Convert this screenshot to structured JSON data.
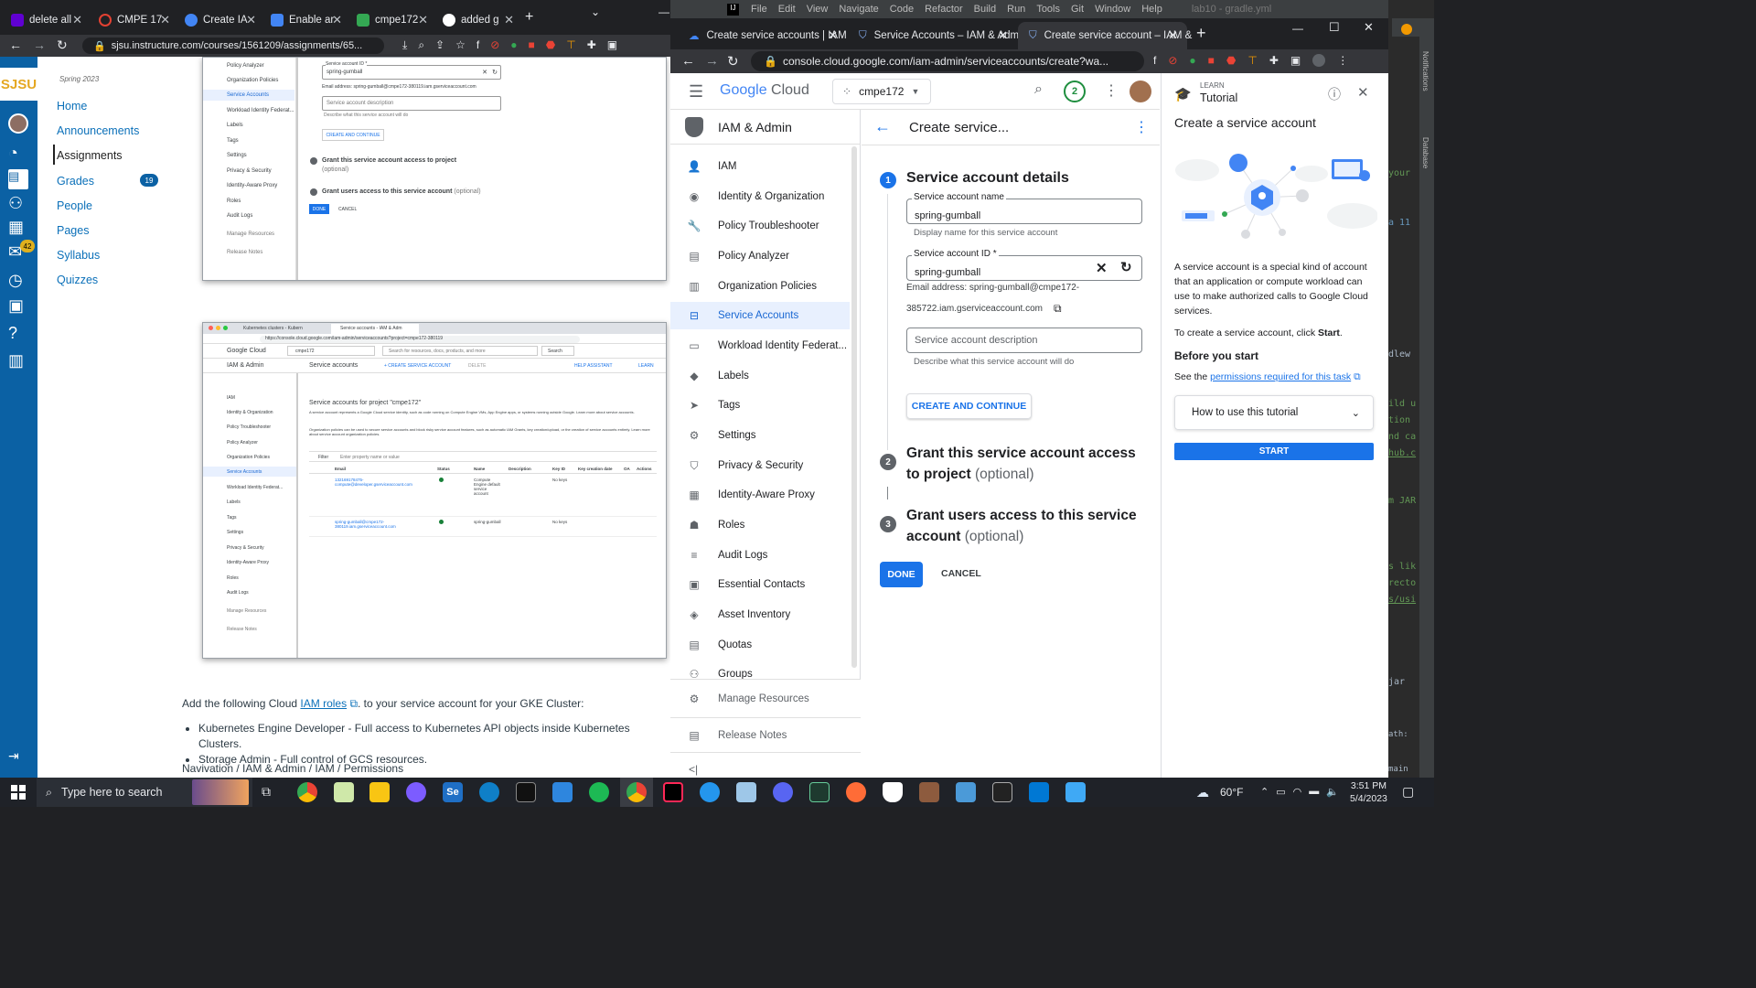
{
  "left_browser": {
    "tabs": [
      {
        "label": "delete all",
        "favicon_color": "#6001d2"
      },
      {
        "label": "CMPE 17",
        "favicon_color": "#e34132"
      },
      {
        "label": "Create IA",
        "favicon_color": "#4285f4"
      },
      {
        "label": "Enable ar",
        "favicon_color": "#4285f4"
      },
      {
        "label": "cmpe172",
        "favicon_color": "#34a853"
      },
      {
        "label": "added g",
        "favicon_color": "#ffffff"
      }
    ],
    "url": "sjsu.instructure.com/courses/1561209/assignments/65...",
    "canvas": {
      "logo": "SJSU",
      "term": "Spring 2023",
      "links": [
        "Home",
        "Announcements",
        "Assignments",
        "Grades",
        "People",
        "Pages",
        "Syllabus",
        "Quizzes"
      ],
      "grades_badge": "19",
      "inbox_badge": "42"
    },
    "embedded_shot1": {
      "sidebar": [
        "Policy Analyzer",
        "Organization Policies",
        "Service Accounts",
        "Workload Identity Federat...",
        "Labels",
        "Tags",
        "Settings",
        "Privacy & Security",
        "Identity-Aware Proxy",
        "Roles",
        "Audit Logs",
        "Manage Resources",
        "Release Notes"
      ],
      "id_label": "Service account ID *",
      "id_value": "spring-gumball",
      "email": "Email address: spring-gumball@cmpe172-380119.iam.gserviceaccount.com",
      "desc_placeholder": "Service account description",
      "desc_helper": "Describe what this service account will do",
      "create_btn": "CREATE AND CONTINUE",
      "step2": "Grant this service account access to project",
      "step2_opt": "(optional)",
      "step3": "Grant users access to this service account",
      "step3_opt": "(optional)",
      "done": "DONE",
      "cancel": "CANCEL"
    },
    "embedded_shot2": {
      "tabs": [
        "Kubernetes clusters - Kubern",
        "Service accounts - IAM & Adm"
      ],
      "url": "https://console.cloud.google.com/iam-admin/serviceaccounts?project=cmpe172-380119",
      "logo": "Google Cloud",
      "project": "cmpe172",
      "search": "Search for resources, docs, products, and more",
      "search_btn": "Search",
      "section": "IAM & Admin",
      "page_title": "Service accounts",
      "create_link": "+ CREATE SERVICE ACCOUNT",
      "delete_link": "DELETE",
      "help": "HELP ASSISTANT",
      "learn": "LEARN",
      "sidebar": [
        "IAM",
        "Identity & Organization",
        "Policy Troubleshooter",
        "Policy Analyzer",
        "Organization Policies",
        "Service Accounts",
        "Workload Identity Federat...",
        "Labels",
        "Tags",
        "Settings",
        "Privacy & Security",
        "Identity-Aware Proxy",
        "Roles",
        "Audit Logs",
        "Manage Resources",
        "Release Notes"
      ],
      "heading": "Service accounts for project \"cmpe172\"",
      "para1": "A service account represents a Google Cloud service identity, such as code running on Compute Engine VMs, App Engine apps, or systems running outside Google. Learn more about service accounts.",
      "para2": "Organization policies can be used to secure service accounts and block risky service account features, such as automatic IAM Grants, key creation/upload, or the creation of service accounts entirely. Learn more about service account organization policies.",
      "filter": "Filter",
      "filter_placeholder": "Enter property name or value",
      "columns": [
        "Email",
        "Status",
        "Name",
        "Description",
        "Key ID",
        "Key creation date",
        "OA",
        "Actions"
      ],
      "rows": [
        {
          "email": "132169178475-compute@developer.gserviceaccount.com",
          "name": "Compute Engine default service account",
          "key": "No keys"
        },
        {
          "email": "spring-gumball@cmpe172-380119.iam.gserviceaccount.com",
          "name": "spring-gumball",
          "key": "No keys"
        }
      ]
    },
    "instructions": {
      "text_before": "Add the following Cloud ",
      "link": "IAM roles",
      "text_after": ". to your service account for your GKE Cluster:",
      "bullets": [
        "Kubernetes Engine Developer - Full access to Kubernetes API objects inside Kubernetes Clusters.",
        "Storage Admin - Full control of GCS resources."
      ],
      "nav": "Navivation / IAM & Admin / IAM / Permissions"
    }
  },
  "right_browser": {
    "menu": [
      "File",
      "Edit",
      "View",
      "Navigate",
      "Code",
      "Refactor",
      "Build",
      "Run",
      "Tools",
      "Git",
      "Window",
      "Help"
    ],
    "ide_title": "lab10 - gradle.yml",
    "tabs": [
      {
        "label": "Create service accounts | IAM",
        "active": false
      },
      {
        "label": "Service Accounts – IAM & Adm",
        "active": false
      },
      {
        "label": "Create service account – IAM &",
        "active": true
      }
    ],
    "url": "console.cloud.google.com/iam-admin/serviceaccounts/create?wa...",
    "logo_google": "Google",
    "logo_cloud": "Cloud",
    "project": "cmpe172",
    "notif_count": "2",
    "section": "IAM & Admin",
    "page_title": "Create service...",
    "sidebar": [
      "IAM",
      "Identity & Organization",
      "Policy Troubleshooter",
      "Policy Analyzer",
      "Organization Policies",
      "Service Accounts",
      "Workload Identity Federat...",
      "Labels",
      "Tags",
      "Settings",
      "Privacy & Security",
      "Identity-Aware Proxy",
      "Roles",
      "Audit Logs",
      "Essential Contacts",
      "Asset Inventory",
      "Quotas",
      "Groups"
    ],
    "sidebar_footer": [
      "Manage Resources",
      "Release Notes"
    ],
    "form": {
      "step1_num": "1",
      "step1_title": "Service account details",
      "name_label": "Service account name",
      "name_value": "spring-gumball",
      "name_helper": "Display name for this service account",
      "id_label": "Service account ID *",
      "id_value": "spring-gumball",
      "email_line1": "Email address: spring-gumball@cmpe172-",
      "email_line2": "385722.iam.gserviceaccount.com",
      "desc_placeholder": "Service account description",
      "desc_helper": "Describe what this service account will do",
      "create_btn": "CREATE AND CONTINUE",
      "step2_num": "2",
      "step2_title_a": "Grant this service account access",
      "step2_title_b": "to project",
      "step2_opt": "(optional)",
      "step3_num": "3",
      "step3_title_a": "Grant users access to this service",
      "step3_title_b": "account",
      "step3_opt": "(optional)",
      "done": "DONE",
      "cancel": "CANCEL"
    },
    "tutorial": {
      "kicker": "LEARN",
      "title": "Tutorial",
      "heading": "Create a service account",
      "para": "A service account is a special kind of account that an application or compute workload can use to make authorized calls to Google Cloud services.",
      "click_start_a": "To create a service account, click ",
      "click_start_b": "Start",
      "click_start_c": ".",
      "before": "Before you start",
      "see_a": "See the ",
      "see_link": "permissions required for this task",
      "howto": "How to use this tutorial",
      "start": "START"
    }
  },
  "ide_strip": {
    "side_labels": [
      "Notifications",
      "Database"
    ],
    "code_fragments": [
      "your",
      "a 11",
      "dlew",
      "ild u",
      "tion",
      "nd ca",
      "hub.c",
      "m JAR",
      "s lik",
      "recto",
      "s/usi",
      "jar",
      "ath:",
      "main"
    ]
  },
  "taskbar": {
    "search_placeholder": "Type here to search",
    "weather": "60°F",
    "time": "3:51 PM",
    "date": "5/4/2023"
  },
  "colors": {
    "canvas_nav": "#0b61a4",
    "google_blue": "#1a73e8",
    "start_blue": "#1a73e8",
    "done_blue": "#1a73e8"
  }
}
